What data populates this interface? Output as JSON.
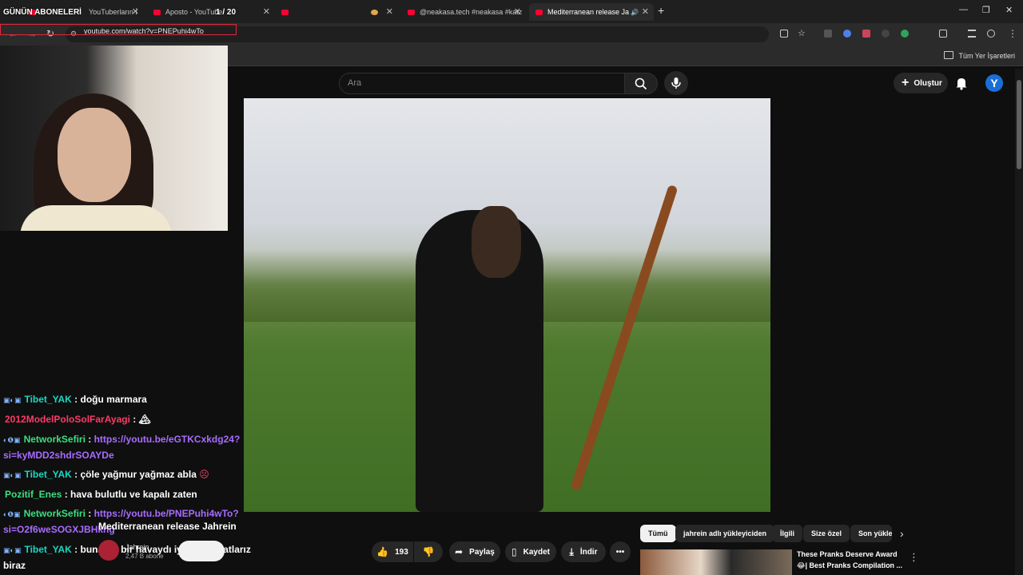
{
  "tabs": [
    {
      "label": "YouTuberların İ"
    },
    {
      "label": "Aposto - YouTube"
    },
    {
      "label": ""
    },
    {
      "label": ""
    },
    {
      "label": "@neakasa.tech #neakasa #katz"
    },
    {
      "label": "Mediterranean release Jahre"
    }
  ],
  "browser": {
    "url": "youtube.com/watch?v=PNEPuhi4wTo",
    "bookmarks_all": "Tüm Yer İşaretleri"
  },
  "overlay": {
    "title": "GÜNÜN ABONELERİ",
    "counter": "1 / 20"
  },
  "youtube": {
    "search_placeholder": "Ara",
    "create_label": "Oluştur",
    "avatar_letter": "Y"
  },
  "chat": [
    {
      "user": "Tibet_YAK",
      "sep": " : ",
      "text": "doğu marmara",
      "color": "blue"
    },
    {
      "user": "2012ModelPoloSolFarAyagi",
      "sep": " : ",
      "text": "🏔",
      "color": "red"
    },
    {
      "user": "NetworkSefiri",
      "sep": " : ",
      "text": "https://youtu.be/eGTKCxkdg24?",
      "text2": "si=kyMDD2shdrSOAYDe",
      "color": "green",
      "link": true
    },
    {
      "user": "Tibet_YAK",
      "sep": " : ",
      "text": "çöle yağmur yağmaz abla",
      "color": "blue"
    },
    {
      "user": "Pozitif_Enes",
      "sep": " : ",
      "text": "hava bulutlu ve kapalı zaten",
      "color": "green"
    },
    {
      "user": "NetworkSefiri",
      "sep": " : ",
      "text": "https://youtu.be/PNEPuhi4wTo?",
      "text2": "si=O2f6weSOGXJBHkng",
      "color": "green",
      "link": true
    },
    {
      "user": "Tibet_YAK",
      "sep": " : ",
      "text": "bunaltıır bir havaydı iyi olur rahatlarız",
      "text2": "biraz",
      "color": "blue"
    }
  ],
  "video": {
    "title": "Mediterranean release Jahrein",
    "channel": "Jahrein",
    "subscribers": "2,47 B abone",
    "likes": "193",
    "share": "Paylaş",
    "save": "Kaydet",
    "download": "İndir"
  },
  "chips": [
    "Tümü",
    "jahrein adlı yükleyiciden",
    "İlgili",
    "Size özel",
    "Son yükle"
  ],
  "recommendation": {
    "title_line1": "These Pranks Deserve Award",
    "title_line2": "😂| Best Pranks Compilation ..."
  }
}
